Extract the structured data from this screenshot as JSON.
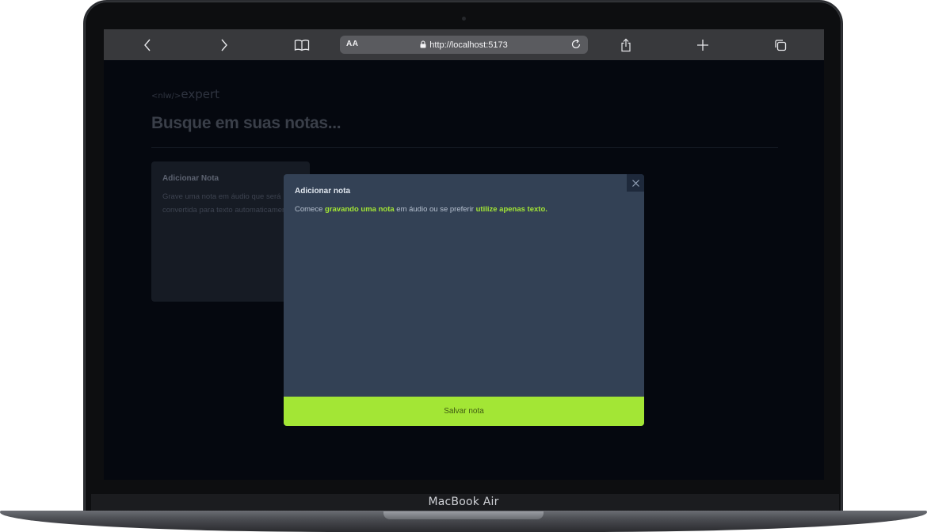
{
  "device": {
    "model_label": "MacBook Air"
  },
  "browser": {
    "aa_label": "AA",
    "url": "http://localhost:5173",
    "icons": [
      "chevron-left-icon",
      "chevron-right-icon",
      "book-icon",
      "lock-icon",
      "reload-icon",
      "share-icon",
      "plus-icon",
      "tabs-icon"
    ]
  },
  "page": {
    "logo_prefix": "<nlw/>",
    "logo_suffix": "expert",
    "title": "Busque em suas notas...",
    "card": {
      "title": "Adicionar Nota",
      "description": "Grave uma nota em áudio que será convertida para texto automaticamente."
    }
  },
  "modal": {
    "title": "Adicionar nota",
    "text_before": "Comece ",
    "link_record": "gravando uma nota",
    "text_middle": " em áudio ou se preferir ",
    "link_text": "utilize apenas texto.",
    "close_glyph": "×",
    "save_label": "Salvar nota"
  },
  "colors": {
    "accent": "#a3e635",
    "modal_bg": "#334155",
    "page_bg": "#05080f"
  }
}
